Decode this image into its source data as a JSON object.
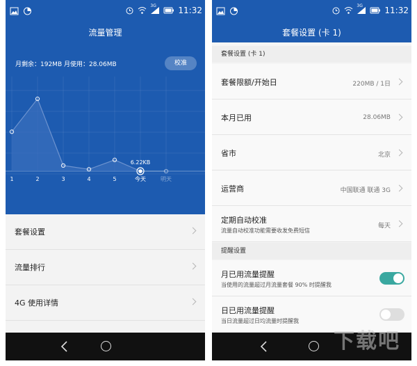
{
  "status_bar": {
    "time": "11:32",
    "network": "3G",
    "icons": [
      "image-icon",
      "data-saver-icon",
      "alarm-icon",
      "wifi-icon",
      "signal-icon",
      "battery-icon"
    ]
  },
  "left": {
    "title": "流量管理",
    "usage_text": "月剩余：192MB 月使用：28.06MB",
    "calibrate_label": "校准",
    "chart_data": {
      "type": "line",
      "categories": [
        "1",
        "2",
        "3",
        "4",
        "5",
        "今天",
        "明天"
      ],
      "values": [
        100,
        135,
        64,
        60,
        70,
        58,
        58
      ],
      "point_label": "6.22KB",
      "point_label_index": 5,
      "grid": true,
      "colors": {
        "line": "#6d93cf",
        "fill": "#3a6fbd",
        "point": "#ffffff"
      }
    },
    "menu": [
      {
        "label": "套餐设置"
      },
      {
        "label": "流量排行"
      },
      {
        "label": "4G 使用详情"
      }
    ]
  },
  "right": {
    "title": "套餐设置 (卡 1)",
    "section1": "套餐设置 (卡 1)",
    "rows": [
      {
        "label": "套餐限额/开始日",
        "value": "220MB / 1日"
      },
      {
        "label": "本月已用",
        "value": "28.06MB"
      },
      {
        "label": "省市",
        "value": "北京"
      },
      {
        "label": "运营商",
        "value": "中国联通 联通 3G"
      },
      {
        "label": "定期自动校准",
        "sub": "流量自动校准功能需要收发免费短信",
        "value": "每天"
      }
    ],
    "section2": "提醒设置",
    "toggles": [
      {
        "label": "月已用流量提醒",
        "sub": "当使用的流量超过月流量套餐 90% 时提醒我",
        "on": true
      },
      {
        "label": "日已用流量提醒",
        "sub": "当日流量超过日均流量时提醒我",
        "on": false
      }
    ],
    "watermark": "下载吧"
  },
  "colors": {
    "header_blue": "#1d5bb0",
    "toggle_on": "#3aa8a0",
    "toggle_off": "#dedede"
  }
}
